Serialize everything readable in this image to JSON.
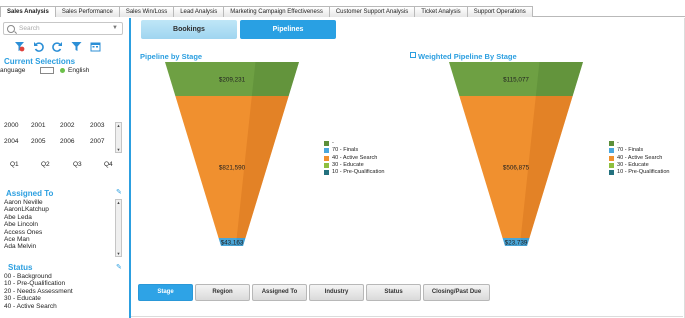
{
  "top_tabs": [
    "Sales Analysis",
    "Sales Performance",
    "Sales Win/Loss",
    "Lead Analysis",
    "Marketing Campaign Effectiveness",
    "Customer Support Analysis",
    "Ticket Analysis",
    "Support Operations"
  ],
  "search": {
    "placeholder": "Search"
  },
  "current_selections": {
    "title": "Current Selections",
    "field": "anguage",
    "value": "English"
  },
  "years": [
    "2000",
    "2001",
    "2002",
    "2003",
    "2004",
    "2005",
    "2006",
    "2007"
  ],
  "quarters": [
    "Q1",
    "Q2",
    "Q3",
    "Q4"
  ],
  "assigned_to": {
    "title": "Assigned To",
    "items": [
      "Aaron Neville",
      "AaronLKatchup",
      "Abe Leda",
      "Abe Lincoln",
      "Access Ones",
      "Ace Man",
      "Ada Melvin"
    ]
  },
  "status": {
    "title": "Status",
    "items": [
      "00 - Background",
      "10 - Pre-Qualification",
      "20 - Needs Assessment",
      "30 - Educate",
      "40 - Active Search"
    ]
  },
  "mid_tabs": {
    "bookings": "Bookings",
    "pipelines": "Pipelines"
  },
  "chart_data": [
    {
      "type": "funnel",
      "title": "Pipeline by Stage",
      "stages": [
        {
          "label": "30 - Educate",
          "value": "$209,231",
          "color": "#6ea043"
        },
        {
          "label": "40 - Active Search",
          "value": "$821,590",
          "color": "#f0902f"
        },
        {
          "label": "70 - Finals",
          "value": "$43,163",
          "color": "#4aa6d8"
        }
      ],
      "legend": [
        "-",
        "70 - Finals",
        "40 - Active Search",
        "30 - Educate",
        "10 - Pre-Qualification"
      ],
      "legend_colors": [
        "#5c8f3a",
        "#49a7dd",
        "#f0902f",
        "#8fbf3f",
        "#23717e"
      ]
    },
    {
      "type": "funnel",
      "title": "Weighted Pipeline By Stage",
      "stages": [
        {
          "label": "30 - Educate",
          "value": "$115,077",
          "color": "#6ea043"
        },
        {
          "label": "40 - Active Search",
          "value": "$506,875",
          "color": "#f0902f"
        },
        {
          "label": "70 - Finals",
          "value": "$23,739",
          "color": "#4aa6d8"
        }
      ],
      "legend": [
        "-",
        "70 - Finals",
        "40 - Active Search",
        "30 - Educate",
        "10 - Pre-Qualification"
      ],
      "legend_colors": [
        "#5c8f3a",
        "#49a7dd",
        "#f0902f",
        "#8fbf3f",
        "#23717e"
      ]
    }
  ],
  "bottom_buttons": [
    "Stage",
    "Region",
    "Assigned To",
    "Industry",
    "Status",
    "Closing/Past Due"
  ],
  "colors": {
    "accent": "#2c9fe0"
  },
  "icons": [
    "search-icon",
    "clear-selections-icon",
    "back-icon",
    "forward-icon",
    "filter-icon",
    "calendar-icon",
    "pencil-icon"
  ]
}
